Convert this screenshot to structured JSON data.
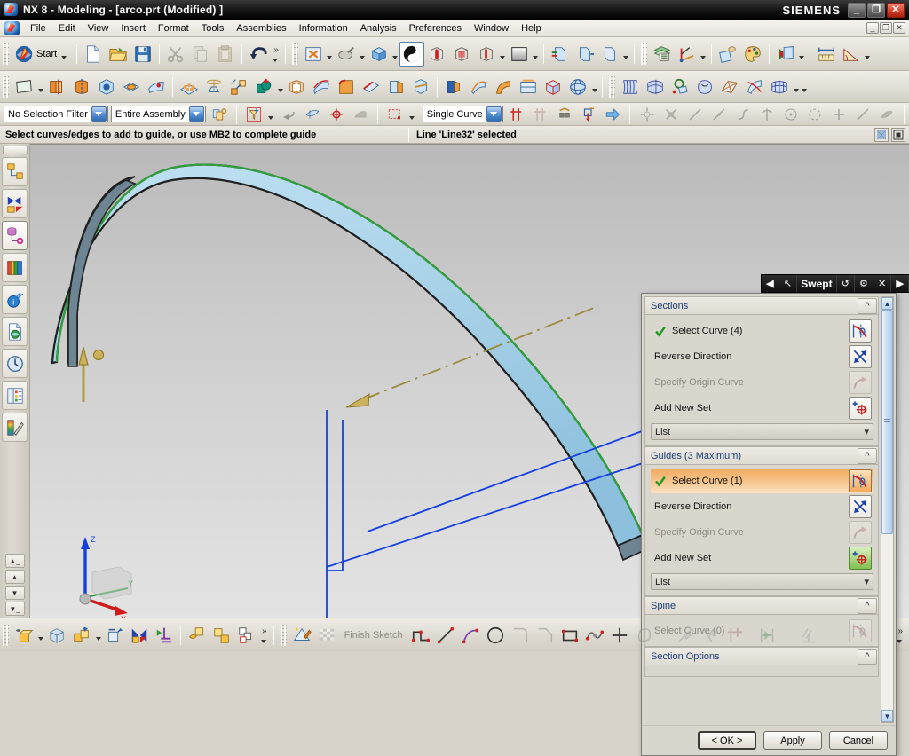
{
  "window": {
    "title": "NX 8 - Modeling - [arco.prt (Modified) ]",
    "brand": "SIEMENS",
    "app_icon": "nx-logo-icon",
    "buttons": {
      "minimize": "_",
      "restore": "❐",
      "close": "✕"
    }
  },
  "menu": {
    "app_icon": "nx-logo-icon",
    "items": [
      {
        "label": "File"
      },
      {
        "label": "Edit"
      },
      {
        "label": "View"
      },
      {
        "label": "Insert"
      },
      {
        "label": "Format"
      },
      {
        "label": "Tools"
      },
      {
        "label": "Assemblies"
      },
      {
        "label": "Information"
      },
      {
        "label": "Analysis"
      },
      {
        "label": "Preferences"
      },
      {
        "label": "Window"
      },
      {
        "label": "Help"
      }
    ],
    "mdi_buttons": {
      "minimize": "_",
      "restore": "❐",
      "close": "✕"
    }
  },
  "toolbar_standard": {
    "start_label": "Start",
    "start_icon": "nx-start-icon",
    "items": [
      {
        "icon": "new-document-icon"
      },
      {
        "icon": "open-folder-icon"
      },
      {
        "icon": "save-floppy-icon"
      },
      {
        "icon": "cut-scissors-icon"
      },
      {
        "icon": "copy-icon"
      },
      {
        "icon": "paste-icon"
      },
      {
        "icon": "undo-arrow-icon"
      }
    ],
    "overflow": "»",
    "view_items": [
      {
        "icon": "fit-view-icon"
      },
      {
        "icon": "zoom-icon"
      },
      {
        "icon": "rotate-cube-icon"
      },
      {
        "icon": "shaded-sphere-icon"
      },
      {
        "icon": "section-cube-icon"
      },
      {
        "icon": "wireframe-cube-icon"
      },
      {
        "icon": "static-wireframe-icon"
      },
      {
        "icon": "gradient-background-icon"
      },
      {
        "icon": "front-view-icon"
      },
      {
        "icon": "right-view-icon"
      },
      {
        "icon": "top-view-icon"
      },
      {
        "icon": "layer-settings-icon"
      },
      {
        "icon": "wcs-axis-icon"
      },
      {
        "icon": "move-face-icon"
      },
      {
        "icon": "palette-edit-icon"
      },
      {
        "icon": "object-display-icon"
      },
      {
        "icon": "measure-distance-icon"
      },
      {
        "icon": "measure-angle-icon"
      }
    ]
  },
  "toolbar_feature": {
    "items": [
      {
        "icon": "datum-plane-icon"
      },
      {
        "icon": "extrude-icon"
      },
      {
        "icon": "revolve-icon"
      },
      {
        "icon": "hole-icon"
      },
      {
        "icon": "boss-pad-icon"
      },
      {
        "icon": "pocket-icon"
      },
      {
        "icon": "pattern-feature-icon"
      },
      {
        "icon": "draft-icon"
      },
      {
        "icon": "move-object-icon"
      },
      {
        "icon": "unite-boolean-icon"
      },
      {
        "icon": "shell-icon"
      },
      {
        "icon": "offset-face-icon"
      },
      {
        "icon": "edge-blend-icon"
      },
      {
        "icon": "chamfer-icon"
      },
      {
        "icon": "trim-body-icon"
      },
      {
        "icon": "split-body-icon"
      },
      {
        "icon": "thread-icon"
      },
      {
        "icon": "rib-icon"
      },
      {
        "icon": "sweep-along-guide-icon"
      },
      {
        "icon": "tube-icon"
      },
      {
        "icon": "box-primitive-icon"
      },
      {
        "icon": "sphere-primitive-icon"
      },
      {
        "icon": "ruled-surface-icon"
      },
      {
        "icon": "through-curve-mesh-icon"
      },
      {
        "icon": "studio-surface-icon"
      },
      {
        "icon": "n-sided-surface-icon"
      },
      {
        "icon": "bounded-plane-icon"
      },
      {
        "icon": "trim-sheet-icon"
      },
      {
        "icon": "sew-sheet-icon"
      }
    ]
  },
  "selection_bar": {
    "filter": {
      "value": "No Selection Filter",
      "icon": "chevron-down-icon"
    },
    "scope": {
      "value": "Entire Assembly",
      "icon": "chevron-down-icon"
    },
    "snap_group_icon": "snap-group-icon",
    "items": [
      {
        "icon": "selection-filter-icon"
      },
      {
        "icon": "deselect-icon"
      },
      {
        "icon": "highlight-hidden-icon"
      },
      {
        "icon": "select-point-icon"
      },
      {
        "icon": "faceted-body-icon"
      },
      {
        "icon": "rectangle-select-icon"
      }
    ],
    "curve_rule": {
      "value": "Single Curve",
      "icon": "chevron-down-icon"
    },
    "curve_items": [
      {
        "icon": "stop-at-intersection-icon"
      },
      {
        "icon": "follow-fillet-icon"
      },
      {
        "icon": "chain-within-feature-icon"
      },
      {
        "icon": "tangent-stop-icon"
      },
      {
        "icon": "next-arrow-icon"
      }
    ],
    "snap_items": [
      {
        "icon": "snap-enable-icon"
      },
      {
        "icon": "snap-point-icon"
      },
      {
        "icon": "end-point-icon"
      },
      {
        "icon": "midpoint-icon"
      },
      {
        "icon": "control-point-icon"
      },
      {
        "icon": "intersection-point-icon"
      },
      {
        "icon": "arc-center-icon"
      },
      {
        "icon": "quadrant-point-icon"
      },
      {
        "icon": "existing-point-icon"
      },
      {
        "icon": "point-on-curve-icon"
      },
      {
        "icon": "point-on-face-icon"
      },
      {
        "icon": "snap-cube-icon"
      }
    ]
  },
  "status": {
    "cue": "Select curves/edges to add to guide, or use MB2 to complete guide",
    "message": "Line 'Line32' selected",
    "right_icons": [
      {
        "icon": "work-layer-icon"
      },
      {
        "icon": "view-section-icon"
      }
    ]
  },
  "resource_bar": {
    "items": [
      {
        "icon": "assembly-navigator-icon",
        "label": "Assembly Navigator"
      },
      {
        "icon": "constraint-navigator-icon",
        "label": "Constraint Navigator"
      },
      {
        "icon": "part-navigator-icon",
        "label": "Part Navigator",
        "selected": true
      },
      {
        "icon": "reuse-library-icon",
        "label": "Reuse Library"
      },
      {
        "icon": "hd3d-tools-icon",
        "label": "HD3D Tools"
      },
      {
        "icon": "web-browser-icon",
        "label": "Internet Explorer"
      },
      {
        "icon": "history-clock-icon",
        "label": "History"
      },
      {
        "icon": "process-studio-icon",
        "label": "Process Studio"
      },
      {
        "icon": "system-materials-icon",
        "label": "System Materials"
      }
    ],
    "nav_buttons": [
      {
        "icon": "scroll-top-icon"
      },
      {
        "icon": "scroll-up-icon"
      },
      {
        "icon": "scroll-down-icon"
      },
      {
        "icon": "scroll-bottom-icon"
      }
    ]
  },
  "viewport": {
    "wcs": {
      "x_label": "X",
      "y_label": "Y",
      "z_label": "Z"
    },
    "geometry_colors": {
      "surface": "#a9d3ea",
      "surface_dark": "#4d6272",
      "edge": "#1a1a1a",
      "guide_green": "#35a03a",
      "datum_blue": "#1540e0",
      "direction_gold": "#bba24a"
    }
  },
  "dialog": {
    "title": "Swept",
    "title_buttons": [
      {
        "icon": "back-arrow-icon",
        "label": "◀"
      },
      {
        "icon": "pointer-cursor-icon",
        "label": "↖"
      },
      {
        "icon": "reset-icon",
        "label": "↺"
      },
      {
        "icon": "settings-gear-icon",
        "label": "⚙"
      },
      {
        "icon": "close-x-icon",
        "label": "✕"
      },
      {
        "icon": "forward-arrow-icon",
        "label": "▶"
      }
    ],
    "groups": [
      {
        "name": "sections",
        "header": "Sections",
        "collapse_icon": "chevron-up-icon",
        "rows": [
          {
            "label": "Select Curve (4)",
            "state": "complete",
            "check_icon": "green-check-icon",
            "button_icon": "select-curve-icon",
            "highlighted": false
          },
          {
            "label": "Reverse Direction",
            "state": "enabled",
            "button_icon": "reverse-direction-icon",
            "highlighted": false
          },
          {
            "label": "Specify Origin Curve",
            "state": "disabled",
            "button_icon": "origin-curve-icon",
            "highlighted": false
          },
          {
            "label": "Add New Set",
            "state": "enabled",
            "button_icon": "add-new-set-icon",
            "highlighted": false
          }
        ],
        "list_label": "List",
        "list_icon": "chevron-down-icon"
      },
      {
        "name": "guides",
        "header": "Guides (3 Maximum)",
        "collapse_icon": "chevron-up-icon",
        "rows": [
          {
            "label": "Select Curve (1)",
            "state": "complete",
            "check_icon": "green-check-icon",
            "button_icon": "select-curve-icon",
            "highlighted": true
          },
          {
            "label": "Reverse Direction",
            "state": "enabled",
            "button_icon": "reverse-direction-icon",
            "highlighted": false
          },
          {
            "label": "Specify Origin Curve",
            "state": "disabled",
            "button_icon": "origin-curve-icon",
            "highlighted": false
          },
          {
            "label": "Add New Set",
            "state": "active",
            "button_icon": "add-new-set-icon",
            "highlighted": false
          }
        ],
        "list_label": "List",
        "list_icon": "chevron-down-icon"
      },
      {
        "name": "spine",
        "header": "Spine",
        "collapse_icon": "chevron-up-icon",
        "rows": [
          {
            "label": "Select Curve (0)",
            "state": "disabled",
            "button_icon": "select-curve-icon",
            "highlighted": false
          }
        ]
      },
      {
        "name": "section-options",
        "header": "Section Options",
        "collapse_icon": "chevron-up-icon",
        "rows": []
      }
    ],
    "scrollbar": {
      "up_icon": "chevron-up-icon",
      "down_icon": "chevron-down-icon"
    },
    "footer": {
      "ok": "< OK >",
      "apply": "Apply",
      "cancel": "Cancel"
    }
  },
  "bottom_toolbar": {
    "finish_sketch_label": "Finish Sketch",
    "finish_sketch_icon": "checkered-flag-icon",
    "utility_items": [
      {
        "icon": "show-hide-icon"
      },
      {
        "icon": "wireframe-display-icon"
      },
      {
        "icon": "show-hidden-icon"
      },
      {
        "icon": "immediate-hide-icon"
      },
      {
        "icon": "reverse-blank-icon"
      },
      {
        "icon": "show-all-icon"
      },
      {
        "icon": "edit-section-icon"
      },
      {
        "icon": "move-to-layer-icon"
      },
      {
        "icon": "copy-to-layer-icon"
      },
      {
        "icon": "layer-visible-icon"
      }
    ],
    "overflow": "»",
    "sketch_items": [
      {
        "icon": "sketch-in-task-icon"
      },
      {
        "icon": "profile-icon"
      },
      {
        "icon": "line-icon"
      },
      {
        "icon": "arc-icon"
      },
      {
        "icon": "circle-icon"
      },
      {
        "icon": "fillet-icon"
      },
      {
        "icon": "chamfer-sketch-icon"
      },
      {
        "icon": "rectangle-icon"
      },
      {
        "icon": "studio-spline-icon"
      },
      {
        "icon": "point-icon"
      },
      {
        "icon": "offset-curve-icon"
      },
      {
        "icon": "quick-trim-icon"
      },
      {
        "icon": "quick-extend-icon"
      },
      {
        "icon": "make-corner-icon"
      },
      {
        "icon": "quick-dimension-icon"
      },
      {
        "icon": "geometric-constraint-icon"
      }
    ]
  }
}
